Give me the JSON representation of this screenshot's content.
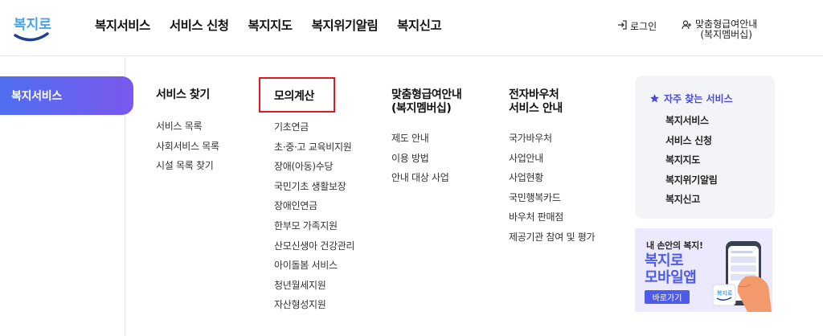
{
  "header": {
    "logo_text": "복지로",
    "gnb": [
      "복지서비스",
      "서비스 신청",
      "복지지도",
      "복지위기알림",
      "복지신고"
    ],
    "login": "로그인",
    "member_line1": "맞춤형급여안내",
    "member_line2": "(복지멤버십)"
  },
  "side": {
    "active": "복지서비스"
  },
  "menu": {
    "col1": {
      "title": "서비스 찾기",
      "items": [
        "서비스 목록",
        "사회서비스 목록",
        "시설 목록 찾기"
      ]
    },
    "col2": {
      "title": "모의계산",
      "items": [
        "기초연금",
        "초·중·고 교육비지원",
        "장애(아동)수당",
        "국민기초 생활보장",
        "장애인연금",
        "한부모 가족지원",
        "산모신생아 건강관리",
        "아이돌봄 서비스",
        "청년월세지원",
        "자산형성지원"
      ]
    },
    "col3": {
      "title_line1": "맞춤형급여안내",
      "title_line2": "(복지멤버십)",
      "items": [
        "제도 안내",
        "이용 방법",
        "안내 대상 사업"
      ]
    },
    "col4": {
      "title_line1": "전자바우처",
      "title_line2": "서비스 안내",
      "items": [
        "국가바우처",
        "사업안내",
        "사업현황",
        "국민행복카드",
        "바우처 판매점",
        "제공기관 참여 및 평가"
      ]
    }
  },
  "favorites": {
    "title": "자주 찾는 서비스",
    "items": [
      "복지서비스",
      "서비스 신청",
      "복지지도",
      "복지위기알림",
      "복지신고"
    ]
  },
  "banner": {
    "line1": "내 손안의 복지!",
    "line2": "복지로",
    "line3": "모바일앱",
    "button": "바로가기",
    "phone_logo": "복지로"
  },
  "colors": {
    "accent": "#4d5bea",
    "pill_start": "#4f6ff0",
    "pill_end": "#7a58ee",
    "highlight": "#e0181f"
  }
}
